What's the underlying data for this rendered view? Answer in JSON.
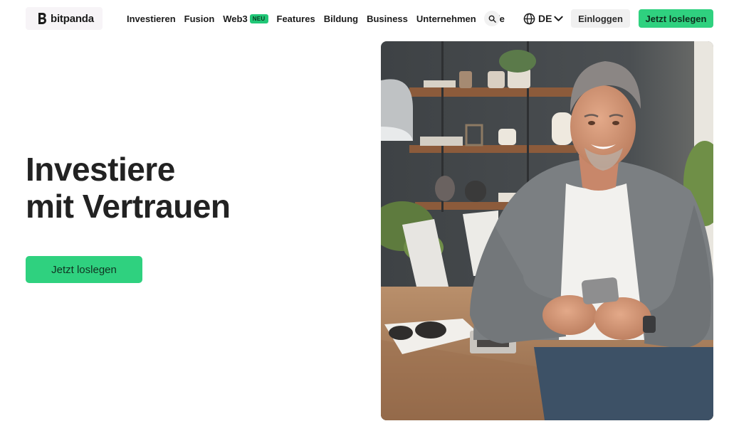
{
  "brand": {
    "name": "bitpanda"
  },
  "nav": {
    "items": [
      {
        "label": "Investieren"
      },
      {
        "label": "Fusion"
      },
      {
        "label": "Web3",
        "badge": "NEU"
      },
      {
        "label": "Features"
      },
      {
        "label": "Bildung"
      },
      {
        "label": "Business"
      },
      {
        "label": "Unternehmen"
      },
      {
        "label": "Hilfe"
      }
    ],
    "search_icon": "search-icon",
    "language": {
      "label": "DE",
      "icon": "globe-icon",
      "chevron": "chevron-down-icon"
    },
    "login_label": "Einloggen",
    "cta_label": "Jetzt loslegen"
  },
  "hero": {
    "title_line1": "Investiere",
    "title_line2": "mit Vertrauen",
    "cta_label": "Jetzt loslegen",
    "image": "man-smiling-with-smartphone-photo"
  },
  "colors": {
    "accent": "#2fd17f",
    "badge": "#21c777",
    "text": "#222222",
    "login_bg": "#f0f0f0"
  }
}
